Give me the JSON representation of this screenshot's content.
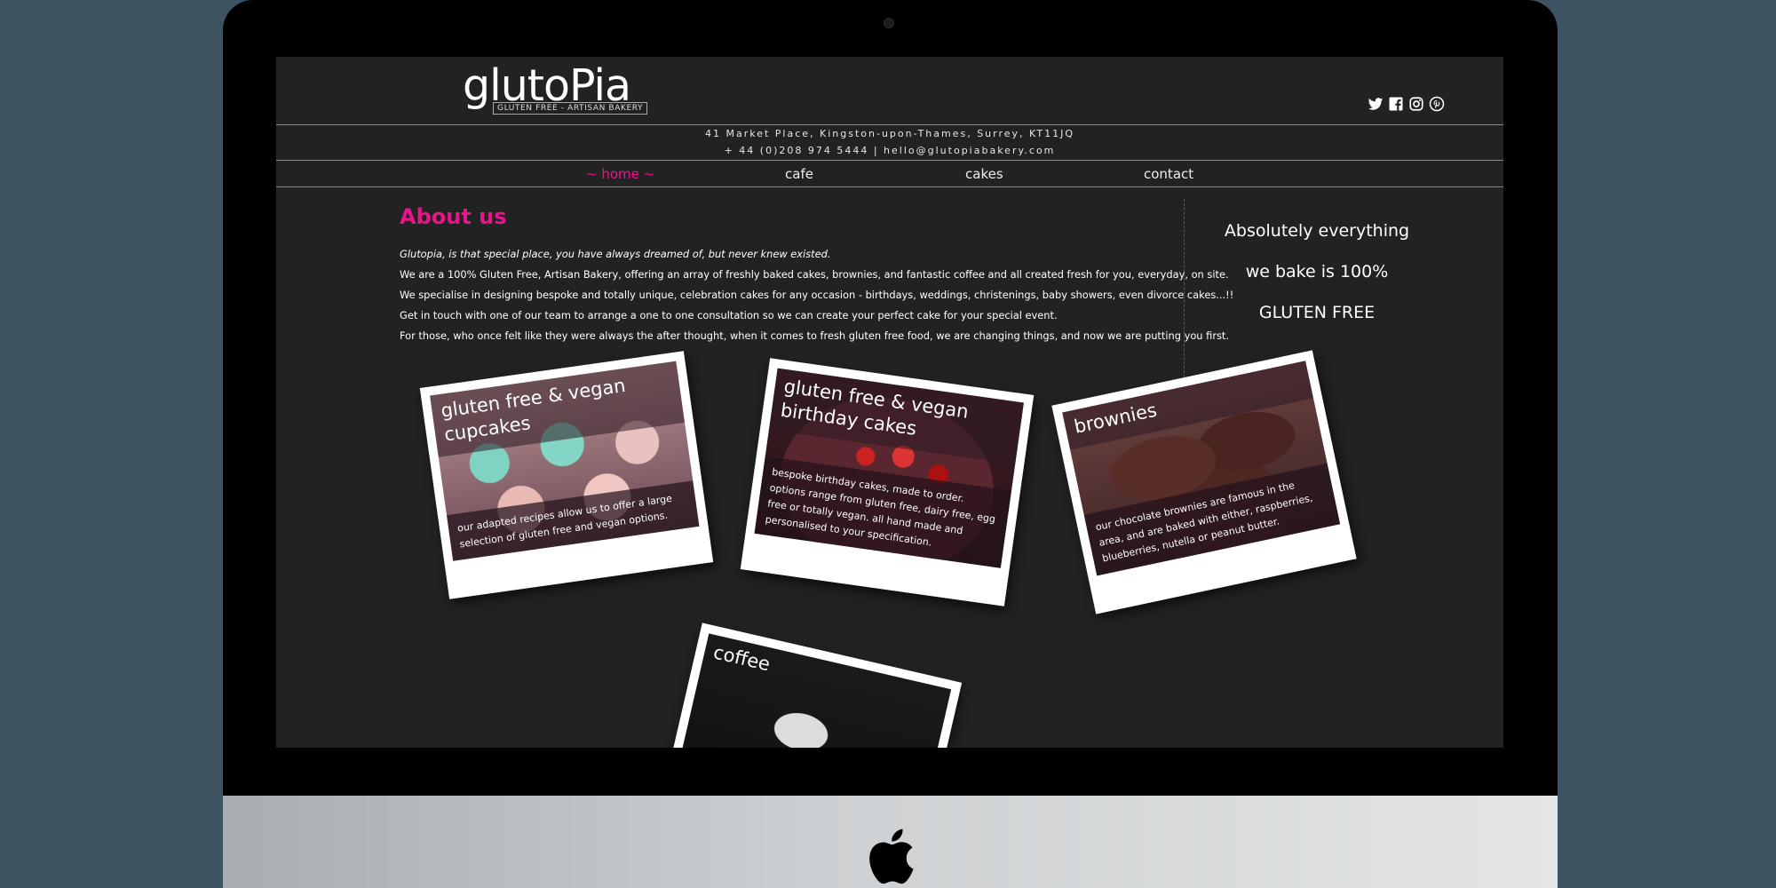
{
  "site": {
    "logo": {
      "name": "glutoPia",
      "tagline": "GLUTEN FREE - ARTISAN BAKERY"
    },
    "socials": [
      "twitter-icon",
      "facebook-icon",
      "instagram-icon",
      "pinterest-icon"
    ],
    "address": "41 Market Place, Kingston-upon-Thames, Surrey, KT11JQ",
    "phone_email": "+ 44 (0)208 974 5444 | hello@glutopiabakery.com"
  },
  "nav": {
    "items": [
      {
        "label": "~ home ~",
        "active": true
      },
      {
        "label": "cafe"
      },
      {
        "label": "cakes"
      },
      {
        "label": "contact"
      }
    ]
  },
  "about": {
    "title": "About us",
    "paragraphs": [
      "Glutopia, is that special place, you have always dreamed of, but never knew existed.",
      "We are a 100% Gluten Free, Artisan Bakery, offering an array of freshly baked cakes, brownies, and fantastic coffee and all created fresh for you, everyday, on site.",
      "We specialise in designing bespoke and totally unique, celebration cakes for any occasion - birthdays, weddings, christenings, baby showers, even divorce cakes...!!",
      "Get in touch with one of our team to arrange a one to one consultation so we can create your perfect cake for your special event.",
      "For those, who once felt like they were always the after thought, when it comes to fresh gluten free food, we are changing things, and now we are putting you first."
    ]
  },
  "tagline": {
    "lines": [
      "Absolutely everything",
      "we bake is 100%",
      "GLUTEN FREE"
    ]
  },
  "cards": [
    {
      "title": "gluten free & vegan cupcakes",
      "description": "our adapted recipes allow us to offer a large selection of gluten free and vegan options."
    },
    {
      "title": "gluten free & vegan birthday cakes",
      "description": "bespoke birthday cakes, made to order. options range from gluten free, dairy free, egg free or totally vegan. all hand made and personalised to your specification."
    },
    {
      "title": "brownies",
      "description": "our chocolate brownies are famous in the area, and are baked with either, raspberries, blueberries, nutella or peanut butter."
    },
    {
      "title": "coffee",
      "description": ""
    }
  ],
  "colors": {
    "accent": "#e8158a",
    "background": "#222222",
    "desktop": "#3e5361"
  }
}
